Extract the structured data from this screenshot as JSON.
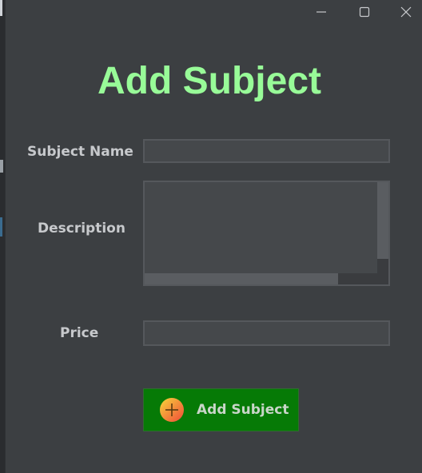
{
  "window": {
    "controls": {
      "minimize_icon": "minimize-icon",
      "maximize_icon": "maximize-icon",
      "close_icon": "close-icon"
    }
  },
  "form": {
    "title": "Add Subject",
    "title_color": "#98fb98",
    "subject_name": {
      "label": "Subject Name",
      "value": ""
    },
    "description": {
      "label": "Description",
      "value": ""
    },
    "price": {
      "label": "Price",
      "value": ""
    },
    "submit": {
      "label": "Add Subject",
      "icon": "plus-circle-icon",
      "background": "#067a06"
    }
  }
}
